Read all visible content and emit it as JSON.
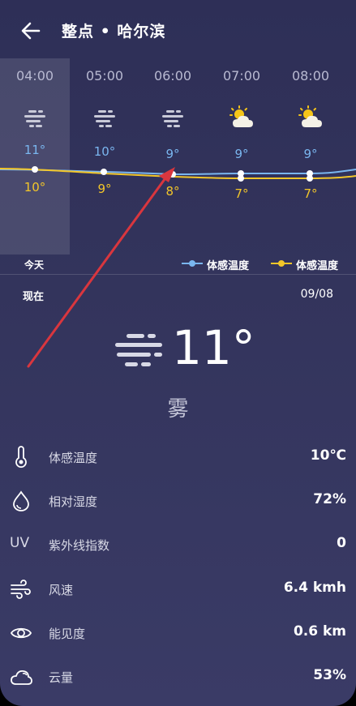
{
  "header": {
    "title": "整点 • 哈尔滨"
  },
  "hourly": [
    {
      "time": "04:00",
      "icon": "fog-icon",
      "feels": "11°",
      "temp": "10°"
    },
    {
      "time": "05:00",
      "icon": "fog-icon",
      "feels": "10°",
      "temp": "9°"
    },
    {
      "time": "06:00",
      "icon": "fog-icon",
      "feels": "9°",
      "temp": "8°"
    },
    {
      "time": "07:00",
      "icon": "sunny-cloudy-icon",
      "feels": "9°",
      "temp": "7°"
    },
    {
      "time": "08:00",
      "icon": "sunny-cloudy-icon",
      "feels": "9°",
      "temp": "7°"
    }
  ],
  "legend": {
    "today": "今天",
    "series_a": "体感温度",
    "series_b": "体感温度"
  },
  "current": {
    "label": "现在",
    "date": "09/08",
    "temp": "11°",
    "condition": "雾"
  },
  "details": [
    {
      "icon": "thermometer-icon",
      "label": "体感温度",
      "value": "10℃"
    },
    {
      "icon": "humidity-drop-icon",
      "label": "相对湿度",
      "value": "72%"
    },
    {
      "icon": "uv-icon",
      "icon_text": "UV",
      "label": "紫外线指数",
      "value": "0"
    },
    {
      "icon": "wind-icon",
      "label": "风速",
      "value": "6.4 kmh"
    },
    {
      "icon": "eye-icon",
      "label": "能见度",
      "value": "0.6 km"
    },
    {
      "icon": "cloud-icon",
      "label": "云量",
      "value": "53%"
    }
  ],
  "colors": {
    "background": "#33345c",
    "feels_series": "#7ab6ef",
    "temp_series": "#f3c629",
    "annotation_arrow": "#d9363e"
  }
}
